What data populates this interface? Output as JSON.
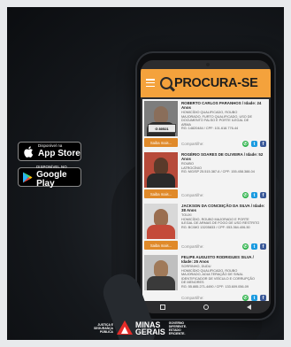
{
  "badges": {
    "apple": {
      "small": "Disponível na",
      "big": "App Store"
    },
    "google": {
      "small": "DISPONÍVEL NO",
      "big": "Google Play"
    }
  },
  "app": {
    "logo": "PROCURA-SE"
  },
  "cards": [
    {
      "name": "ROBERTO CARLOS PARANHOS / Idade: 24 Anos",
      "lines": [
        "HOMICÍDIO QUALIFICADO, ROUBO",
        "MAJORADO, FURTO QUALIFICADO, USO DE",
        "DOCUMENTO FALSO E PORTE ILEGAL DE",
        "ARMA",
        "RG: 14820484 / CPF: 101.618.776-44"
      ],
      "plate": "G 80521",
      "button": "Saiba mais...",
      "share": "Compartilhe:",
      "photo_bg": "#7d7d7d",
      "skin": "#8a6e5a",
      "shirt": "#2a2a2a"
    },
    {
      "name": "ROGÉRIO SOARES DE OLIVEIRA / Idade: 52 Anos",
      "lines": [
        "ROUBO",
        "LATROCÍNIO",
        "RG: MG/SP 25.515.387-6 / CPF: 155.458.388-04"
      ],
      "plate": "",
      "button": "Saiba mais...",
      "share": "Compartilhe:",
      "photo_bg": "#b74a3a",
      "skin": "#5a3a2a",
      "shirt": "#2a2a2a"
    },
    {
      "name": "JACKSON DA CONCEIÇÃO DA SILVA / Idade: 38 Anos",
      "lines": [
        "TOUXI",
        "HOMICÍDIO, ROUBO MAJORADO E PORTE",
        "ILEGAL DE ARMAS DE FOGO DE USO RESTRITO",
        "RG: BC/MG 13205833 / CPF: 053.364.406-50"
      ],
      "plate": "",
      "button": "Saiba mais...",
      "share": "Compartilhe:",
      "photo_bg": "#d8d8d8",
      "skin": "#9a6e50",
      "shirt": "#c44a3a"
    },
    {
      "name": "FELIPE AUGUSTO RODRIGUES SILVA / Idade: 25 Anos",
      "lines": [
        "SORRINHO, DUDU",
        "HOMICÍDIO QUALIFICADO, ROUBO",
        "MAJORADO, ADULTERAÇÃO DE SINAL",
        "IDENTIFICADOR DE VEÍCULO E CORRUPÇÃO",
        "DE MENORES",
        "RG: 55.885.271-4490 / CPF: 133.609.056-09"
      ],
      "plate": "",
      "button": "",
      "share": "Compartilhe:",
      "photo_bg": "#bfbfbf",
      "skin": "#a07a5a",
      "shirt": "#3a3a3a"
    }
  ],
  "footer": {
    "agency": "JUSTIÇA E SEGURANÇA PÚBLICA",
    "brand_line1": "MINAS",
    "brand_line2": "GERAIS",
    "slogan": [
      "GOVERNO",
      "DIFERENTE.",
      "ESTADO",
      "EFICIENTE."
    ]
  },
  "colors": {
    "header": "#f4a23c",
    "button": "#e08a2a",
    "whatsapp": "#2db34a",
    "twitter": "#1b9be0",
    "facebook": "#3b5998",
    "brand_red": "#e52b28"
  }
}
